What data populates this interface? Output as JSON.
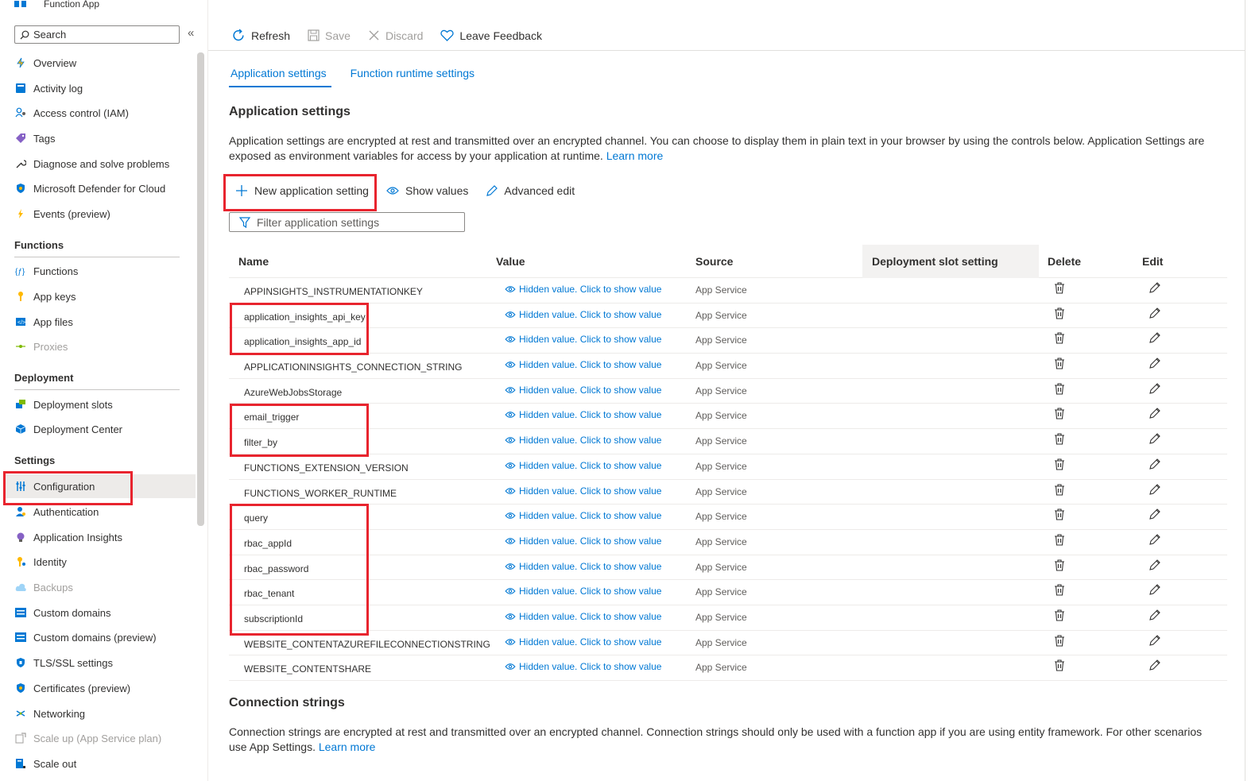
{
  "app": {
    "title": "Function App"
  },
  "nav": {
    "search_placeholder": "Search",
    "collapse": "«",
    "items_top": [
      {
        "label": "Overview",
        "icon": "lightning-overview-icon"
      },
      {
        "label": "Activity log",
        "icon": "activity-log-icon"
      },
      {
        "label": "Access control (IAM)",
        "icon": "people-iam-icon"
      },
      {
        "label": "Tags",
        "icon": "tag-icon"
      },
      {
        "label": "Diagnose and solve problems",
        "icon": "wrench-icon"
      },
      {
        "label": "Microsoft Defender for Cloud",
        "icon": "shield-icon"
      },
      {
        "label": "Events (preview)",
        "icon": "lightning-events-icon"
      }
    ],
    "section_functions": "Functions",
    "items_functions": [
      {
        "label": "Functions",
        "icon": "function-icon"
      },
      {
        "label": "App keys",
        "icon": "key-icon"
      },
      {
        "label": "App files",
        "icon": "code-file-icon"
      },
      {
        "label": "Proxies",
        "icon": "proxy-icon"
      }
    ],
    "section_deployment": "Deployment",
    "items_deployment": [
      {
        "label": "Deployment slots",
        "icon": "deployment-slots-icon"
      },
      {
        "label": "Deployment Center",
        "icon": "cube-icon"
      }
    ],
    "section_settings": "Settings",
    "items_settings": [
      {
        "label": "Configuration",
        "icon": "sliders-icon"
      },
      {
        "label": "Authentication",
        "icon": "person-key-icon"
      },
      {
        "label": "Application Insights",
        "icon": "lightbulb-icon"
      },
      {
        "label": "Identity",
        "icon": "identity-key-icon"
      },
      {
        "label": "Backups",
        "icon": "cloud-backup-icon"
      },
      {
        "label": "Custom domains",
        "icon": "domain-icon"
      },
      {
        "label": "Custom domains (preview)",
        "icon": "domain-preview-icon"
      },
      {
        "label": "TLS/SSL settings",
        "icon": "tls-shield-icon"
      },
      {
        "label": "Certificates (preview)",
        "icon": "certificate-icon"
      },
      {
        "label": "Networking",
        "icon": "networking-icon"
      },
      {
        "label": "Scale up (App Service plan)",
        "icon": "scale-up-icon"
      },
      {
        "label": "Scale out",
        "icon": "scale-out-icon"
      }
    ]
  },
  "toolbar": {
    "refresh": "Refresh",
    "save": "Save",
    "discard": "Discard",
    "feedback": "Leave Feedback"
  },
  "tabs": {
    "app_settings": "Application settings",
    "runtime_settings": "Function runtime settings"
  },
  "app_settings": {
    "heading": "Application settings",
    "description": "Application settings are encrypted at rest and transmitted over an encrypted channel. You can choose to display them in plain text in your browser by using the controls below. Application Settings are exposed as environment variables for access by your application at runtime.",
    "learn_more": "Learn more",
    "new_setting": "New application setting",
    "show_values": "Show values",
    "advanced_edit": "Advanced edit",
    "filter_placeholder": "Filter application settings",
    "columns": {
      "name": "Name",
      "value": "Value",
      "source": "Source",
      "slot": "Deployment slot setting",
      "delete": "Delete",
      "edit": "Edit"
    },
    "hidden_value": "Hidden value. Click to show value",
    "rows": [
      {
        "name": "APPINSIGHTS_INSTRUMENTATIONKEY",
        "source": "App Service"
      },
      {
        "name": "application_insights_api_key",
        "source": "App Service"
      },
      {
        "name": "application_insights_app_id",
        "source": "App Service"
      },
      {
        "name": "APPLICATIONINSIGHTS_CONNECTION_STRING",
        "source": "App Service"
      },
      {
        "name": "AzureWebJobsStorage",
        "source": "App Service"
      },
      {
        "name": "email_trigger",
        "source": "App Service"
      },
      {
        "name": "filter_by",
        "source": "App Service"
      },
      {
        "name": "FUNCTIONS_EXTENSION_VERSION",
        "source": "App Service"
      },
      {
        "name": "FUNCTIONS_WORKER_RUNTIME",
        "source": "App Service"
      },
      {
        "name": "query",
        "source": "App Service"
      },
      {
        "name": "rbac_appId",
        "source": "App Service"
      },
      {
        "name": "rbac_password",
        "source": "App Service"
      },
      {
        "name": "rbac_tenant",
        "source": "App Service"
      },
      {
        "name": "subscriptionId",
        "source": "App Service"
      },
      {
        "name": "WEBSITE_CONTENTAZUREFILECONNECTIONSTRING",
        "source": "App Service"
      },
      {
        "name": "WEBSITE_CONTENTSHARE",
        "source": "App Service"
      }
    ]
  },
  "connection_strings": {
    "heading": "Connection strings",
    "description": "Connection strings are encrypted at rest and transmitted over an encrypted channel. Connection strings should only be used with a function app if you are using entity framework. For other scenarios use App Settings.",
    "learn_more": "Learn more"
  },
  "colors": {
    "accent": "#0078d4",
    "highlight": "#e8242e"
  }
}
